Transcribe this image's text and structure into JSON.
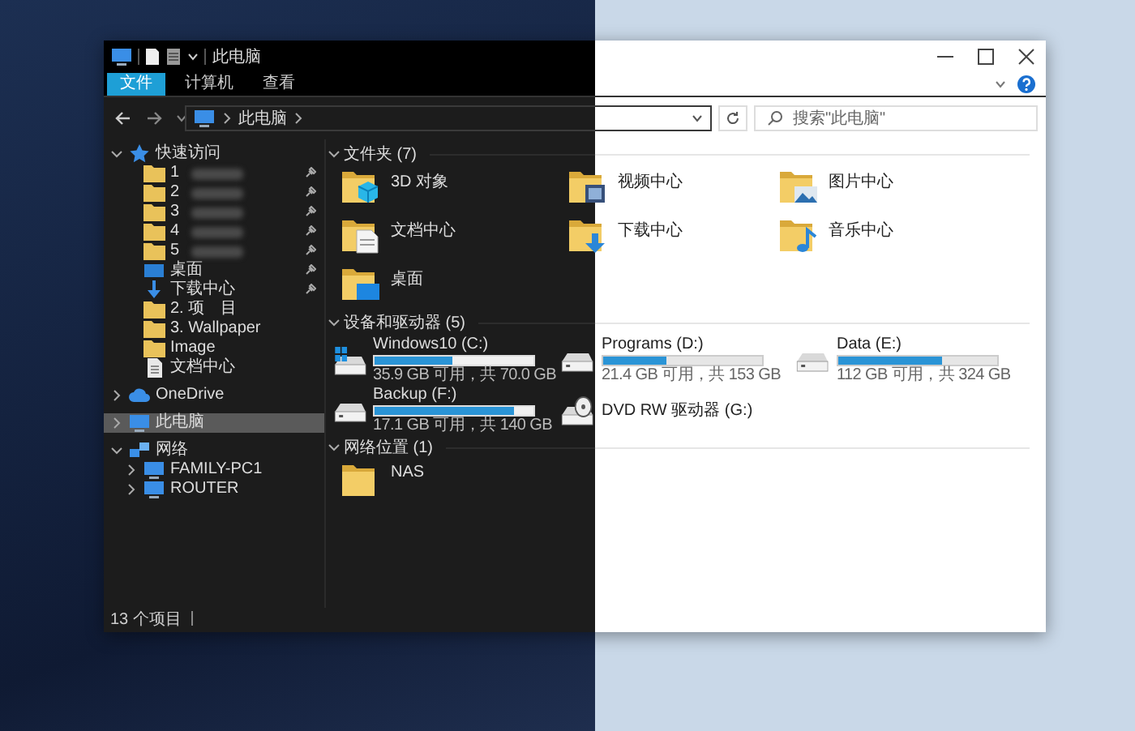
{
  "window": {
    "title": "此电脑"
  },
  "ribbon_tabs": [
    {
      "label": "文件",
      "selected": true
    },
    {
      "label": "计算机",
      "selected": false
    },
    {
      "label": "查看",
      "selected": false
    }
  ],
  "address_bar": {
    "path": "此电脑"
  },
  "search": {
    "placeholder": "搜索\"此电脑\""
  },
  "sidebar": {
    "items": [
      {
        "label": "快速访问",
        "expanded": true,
        "selected": false,
        "children": [
          {
            "label": "1",
            "pinned": true,
            "blurred": true,
            "selected": false
          },
          {
            "label": "2",
            "pinned": true,
            "blurred": true,
            "selected": false
          },
          {
            "label": "3",
            "pinned": true,
            "blurred": true,
            "selected": false
          },
          {
            "label": "4",
            "pinned": true,
            "blurred": true,
            "selected": false
          },
          {
            "label": "5",
            "pinned": true,
            "blurred": true,
            "selected": false
          },
          {
            "label": "桌面",
            "pinned": true,
            "blurred": false,
            "selected": false
          },
          {
            "label": "下载中心",
            "pinned": true,
            "blurred": false,
            "selected": false
          },
          {
            "label": "2. 项　目",
            "pinned": false,
            "blurred": false,
            "selected": false
          },
          {
            "label": "3. Wallpaper",
            "pinned": false,
            "blurred": false,
            "selected": false
          },
          {
            "label": "Image",
            "pinned": false,
            "blurred": false,
            "selected": false
          },
          {
            "label": "文档中心",
            "pinned": false,
            "blurred": false,
            "selected": false
          }
        ]
      },
      {
        "label": "OneDrive",
        "expanded": false,
        "selected": false
      },
      {
        "label": "此电脑",
        "expanded": false,
        "selected": true
      },
      {
        "label": "网络",
        "expanded": true,
        "selected": false,
        "children": [
          {
            "label": "FAMILY-PC1",
            "expanded": false,
            "selected": false
          },
          {
            "label": "ROUTER",
            "expanded": false,
            "selected": false
          }
        ]
      }
    ]
  },
  "groups": [
    {
      "title": "文件夹 (7)",
      "kind": "folders",
      "expanded": true,
      "items": [
        {
          "label": "3D 对象"
        },
        {
          "label": "视频中心"
        },
        {
          "label": "图片中心"
        },
        {
          "label": "文档中心"
        },
        {
          "label": "下载中心"
        },
        {
          "label": "音乐中心"
        },
        {
          "label": "桌面"
        }
      ]
    },
    {
      "title": "设备和驱动器 (5)",
      "kind": "drives",
      "expanded": true,
      "items": [
        {
          "label": "Windows10 (C:)",
          "level": 0.49,
          "reading": "35.9 GB 可用，共 70.0 GB"
        },
        {
          "label": "Programs (D:)",
          "level": 0.4,
          "reading": "21.4 GB 可用，共 153 GB"
        },
        {
          "label": "Data (E:)",
          "level": 0.65,
          "reading": "112 GB 可用，共 324 GB"
        },
        {
          "label": "Backup (F:)",
          "level": 0.88,
          "reading": "17.1 GB 可用，共 140 GB"
        },
        {
          "label": "DVD RW 驱动器 (G:)"
        }
      ]
    },
    {
      "title": "网络位置 (1)",
      "kind": "network",
      "expanded": true,
      "items": [
        {
          "label": "NAS"
        }
      ]
    }
  ],
  "status_bar": {
    "text": "13 个项目"
  }
}
